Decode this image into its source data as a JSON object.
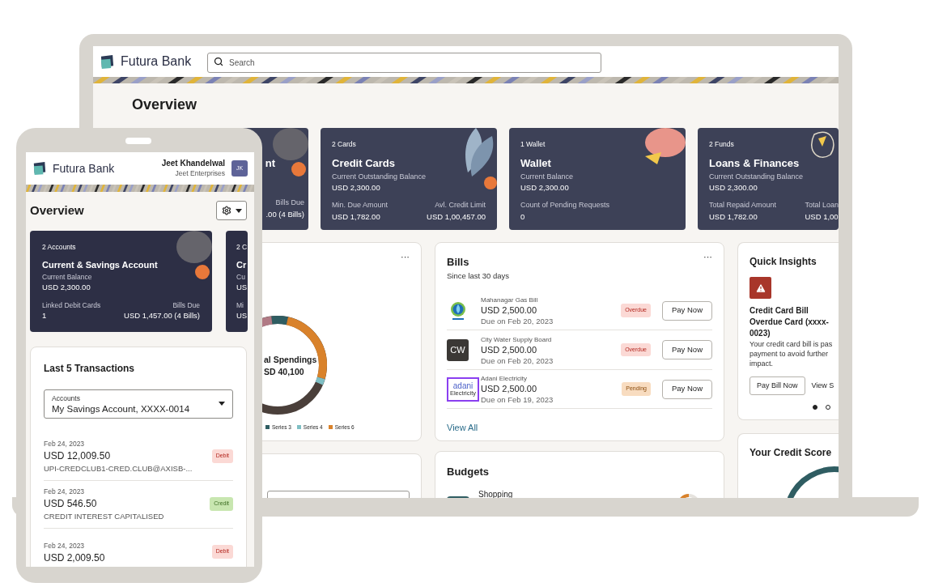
{
  "laptop": {
    "brand": "Futura Bank",
    "search": {
      "placeholder": "Search"
    },
    "title": "Overview",
    "cards": [
      {
        "kind": "partial",
        "title": "nt",
        "fields": [
          [
            {
              "label": "Bills Due",
              "value": ".00 (4 Bills)"
            }
          ]
        ]
      },
      {
        "kind": "full",
        "count": "2 Cards",
        "title": "Credit Cards",
        "fields": [
          [
            {
              "label": "Current Outstanding Balance",
              "value": "USD 2,300.00"
            }
          ],
          [
            {
              "label": "Min. Due Amount",
              "value": "USD 1,782.00"
            },
            {
              "label": "Avl. Credit Limit",
              "value": "USD 1,00,457.00"
            }
          ]
        ]
      },
      {
        "kind": "full",
        "count": "1 Wallet",
        "title": "Wallet",
        "fields": [
          [
            {
              "label": "Current Balance",
              "value": "USD 2,300.00"
            }
          ],
          [
            {
              "label": "Count of Pending Requests",
              "value": "0"
            }
          ]
        ]
      },
      {
        "kind": "cut",
        "count": "2 Funds",
        "title": "Loans & Finances",
        "fields": [
          [
            {
              "label": "Current Outstanding Balance",
              "value": "USD 2,300.00"
            }
          ],
          [
            {
              "label": "Total Repaid Amount",
              "value": "USD 1,782.00"
            },
            {
              "label": "Total Loan",
              "value": "USD 1,00"
            }
          ]
        ]
      }
    ],
    "spendings": {
      "menu": "···",
      "center_label": "al Spendings",
      "center_value": "SD 40,100",
      "legend": [
        {
          "label": "Series 3",
          "color": "#2f5d62"
        },
        {
          "label": "Series 4",
          "color": "#7fbfc4"
        },
        {
          "label": "Series 6",
          "color": "#d9822b"
        }
      ]
    },
    "bills": {
      "title": "Bills",
      "subtitle": "Since last 30 days",
      "menu": "···",
      "items": [
        {
          "logo": {
            "kind": "gas"
          },
          "name": "Mahanagar Gas Bill",
          "amount": "USD 2,500.00",
          "due": "Due on Feb 20, 2023",
          "status": {
            "kind": "overdue",
            "label": "Overdue"
          },
          "action": "Pay Now"
        },
        {
          "logo": {
            "kind": "initials",
            "text": "CW"
          },
          "name": "City Water Supply Board",
          "amount": "USD 2,500.00",
          "due": "Due on Feb 20, 2023",
          "status": {
            "kind": "overdue",
            "label": "Overdue"
          },
          "action": "Pay Now"
        },
        {
          "logo": {
            "kind": "wordmark",
            "text": "adani",
            "subtext": "Electricity"
          },
          "name": "Adani Electricity",
          "amount": "USD 2,500.00",
          "due": "Due on Feb 19, 2023",
          "status": {
            "kind": "pending",
            "label": "Pending"
          },
          "action": "Pay Now"
        }
      ],
      "link": "View All"
    },
    "insights": {
      "title": "Quick Insights",
      "alert_title": "Credit Card Bill Overdue Card (xxxx-0023)",
      "alert_text": "Your credit card bill is pas payment to avoid further impact.",
      "buttons": [
        {
          "kind": "outline",
          "label": "Pay Bill Now"
        },
        {
          "kind": "plain",
          "label": "View S"
        }
      ],
      "dots": [
        {
          "selected": true
        },
        {
          "selected": false
        }
      ]
    },
    "budgets": {
      "title": "Budgets",
      "items": [
        {
          "name": "Shopping"
        }
      ]
    },
    "credit_score": {
      "title": "Your Credit Score"
    }
  },
  "phone": {
    "brand": "Futura Bank",
    "user": {
      "name": "Jeet Khandelwal",
      "company": "Jeet Enterprises",
      "initials": "JK"
    },
    "title": "Overview",
    "cards": [
      {
        "kind": "full",
        "count": "2 Accounts",
        "title": "Current & Savings Account",
        "fields": [
          [
            {
              "label": "Current Balance",
              "value": "USD 2,300.00"
            }
          ],
          [
            {
              "label": "Linked Debit Cards",
              "value": "1"
            },
            {
              "label": "Bills Due",
              "value": "USD 1,457.00 (4 Bills)"
            }
          ]
        ]
      },
      {
        "kind": "cut",
        "count": "2 C",
        "title": "Cr",
        "fields": [
          [
            {
              "label": "Cu",
              "value": "US"
            }
          ],
          [
            {
              "label": "Mi",
              "value": "US"
            }
          ]
        ]
      }
    ],
    "transactions": {
      "title": "Last 5 Transactions",
      "account_select": {
        "label": "Accounts",
        "value": "My Savings Account, XXXX-0014"
      },
      "items": [
        {
          "date": "Feb 24, 2023",
          "amount": "USD 12,009.50",
          "description": "UPI-CREDCLUB1-CRED.CLUB@AXISB-...",
          "badge": {
            "kind": "debit",
            "label": "Debit"
          }
        },
        {
          "date": "Feb 24, 2023",
          "amount": "USD 546.50",
          "description": "CREDIT INTEREST CAPITALISED",
          "badge": {
            "kind": "credit",
            "label": "Credit"
          }
        },
        {
          "date": "Feb 24, 2023",
          "amount": "USD 2,009.50",
          "badge": {
            "kind": "debit",
            "label": "Debit"
          }
        }
      ]
    }
  }
}
